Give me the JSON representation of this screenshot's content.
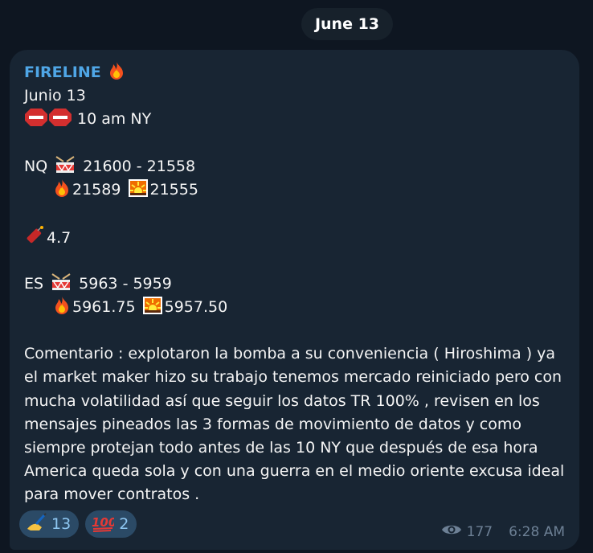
{
  "date_label": "June 13",
  "message": {
    "sender": "FIRELINE",
    "lines": {
      "date": "Junio 13",
      "time_alert": "10 am NY",
      "nq_label": "NQ",
      "nq_range": "21600 - 21558",
      "nq_fire": "21589",
      "nq_burst": "21555",
      "dynamite_value": "4.7",
      "es_label": "ES",
      "es_range": "5963 - 5959",
      "es_fire": "5961.75",
      "es_burst": "5957.50",
      "comment": "Comentario : explotaron la bomba a su conveniencia ( Hiroshima ) ya el market maker hizo su trabajo tenemos mercado reiniciado pero con mucha volatilidad así que seguir los datos TR 100% , revisen en los mensajes pineados las 3 formas de movimiento de datos y como siempre protejan todo antes de las 10 NY que después de esa hora America queda sola y con una guerra en el medio oriente excusa ideal para mover contratos ."
    },
    "reactions": [
      {
        "icon": "writing-hand-icon",
        "count": "13"
      },
      {
        "icon": "hundred-points-icon",
        "count": "2"
      }
    ],
    "views": "177",
    "time": "6:28 AM"
  },
  "colors": {
    "background": "#0e1621",
    "bubble": "#182533",
    "sender": "#4fa6e6",
    "reaction_bg": "#2b4a66",
    "reaction_text": "#8ec7f2",
    "meta_text": "#6d8095"
  }
}
